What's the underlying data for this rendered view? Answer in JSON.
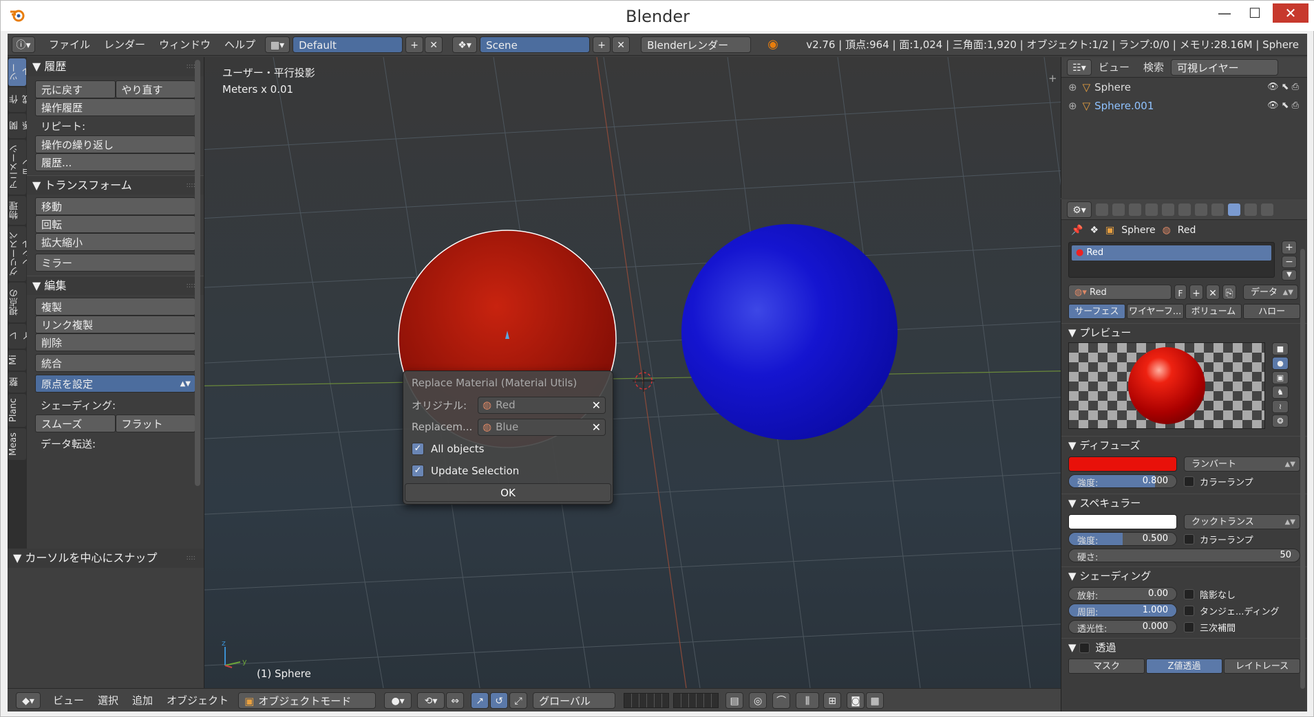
{
  "window": {
    "title": "Blender",
    "min": "—",
    "max": "☐",
    "close": "✕"
  },
  "topbar": {
    "menus": [
      "ファイル",
      "レンダー",
      "ウィンドウ",
      "ヘルプ"
    ],
    "layout": "Default",
    "scene": "Scene",
    "engine": "Blenderレンダー",
    "stats": "v2.76 | 頂点:964 | 面:1,024 | 三角面:1,920 | オブジェクト:1/2 | ランプ:0/0 | メモリ:28.16M | Sphere"
  },
  "tabs": [
    "ツール",
    "作成",
    "関係",
    "アニメーション",
    "物理",
    "グリースペンシル",
    "視点の",
    "レイ",
    "Mi",
    "整",
    "Planc",
    "Meas"
  ],
  "shelf": {
    "history_title": "履歴",
    "undo": "元に戻す",
    "redo": "やり直す",
    "undo_history": "操作履歴",
    "repeat_label": "リピート:",
    "repeat_last": "操作の繰り返し",
    "history": "履歴...",
    "transform_title": "トランスフォーム",
    "move": "移動",
    "rotate": "回転",
    "scale": "拡大縮小",
    "mirror": "ミラー",
    "edit_title": "編集",
    "duplicate": "複製",
    "link_duplicate": "リンク複製",
    "delete": "削除",
    "join": "統合",
    "set_origin": "原点を設定",
    "shading_label": "シェーディング:",
    "smooth": "スムーズ",
    "flat": "フラット",
    "data_transfer_label": "データ転送:",
    "snap_title": "カーソルを中心にスナップ"
  },
  "viewport": {
    "view_name": "ユーザー・平行投影",
    "units": "Meters x 0.01",
    "object_label": "(1) Sphere"
  },
  "dialog": {
    "title": "Replace Material (Material Utils)",
    "original_label": "オリジナル:",
    "original_value": "Red",
    "replace_label": "Replacem...",
    "replace_value": "Blue",
    "all_objects": "All objects",
    "update_selection": "Update Selection",
    "ok": "OK"
  },
  "bottombar": {
    "menus": [
      "ビュー",
      "選択",
      "追加",
      "オブジェクト"
    ],
    "mode": "オブジェクトモード",
    "orientation": "グローバル"
  },
  "outliner": {
    "menus": [
      "ビュー",
      "検索"
    ],
    "layer": "可視レイヤー",
    "items": [
      "Sphere",
      "Sphere.001"
    ]
  },
  "props": {
    "breadcrumb_object": "Sphere",
    "breadcrumb_material": "Red",
    "slot_name": "Red",
    "material_name": "Red",
    "fake_user": "F",
    "data_label": "データ",
    "tabs": [
      "サーフェス",
      "ワイヤーフ...",
      "ボリューム",
      "ハロー"
    ],
    "preview_title": "プレビュー",
    "diffuse_title": "ディフューズ",
    "diffuse_color": "#e8110a",
    "diffuse_shader": "ランバート",
    "diffuse_intensity_label": "強度:",
    "diffuse_intensity": "0.800",
    "diffuse_intensity_fraction": 0.8,
    "ramp": "カラーランプ",
    "specular_title": "スペキュラー",
    "specular_color": "#ffffff",
    "specular_shader": "クックトランス",
    "specular_intensity_label": "強度:",
    "specular_intensity": "0.500",
    "specular_intensity_fraction": 0.5,
    "hardness_label": "硬さ:",
    "hardness": "50",
    "shading_title": "シェーディング",
    "emit_label": "放射:",
    "emit": "0.00",
    "ambient_label": "周囲:",
    "ambient": "1.000",
    "translucency_label": "透光性:",
    "translucency": "0.000",
    "shadeless": "陰影なし",
    "tangent": "タンジェ...ディング",
    "cubic": "三次補間",
    "transparency_title": "透過",
    "transp_tabs": [
      "マスク",
      "Z値透過",
      "レイトレース"
    ]
  }
}
